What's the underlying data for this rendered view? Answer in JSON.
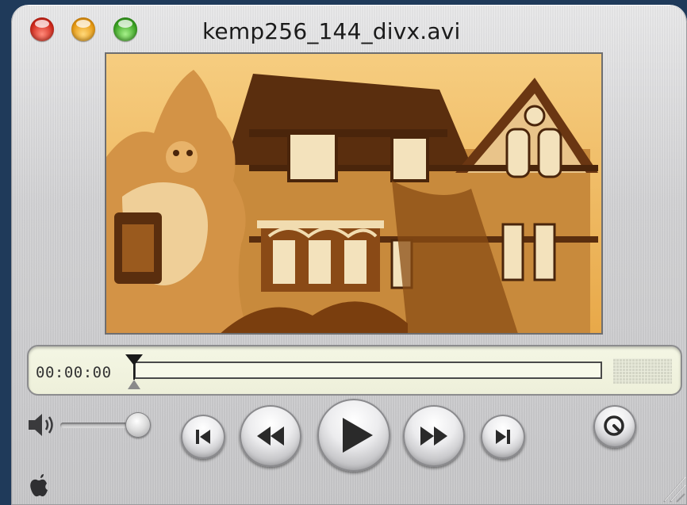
{
  "window": {
    "title": "kemp256_144_divx.avi",
    "traffic_lights": [
      "close-button",
      "minimize-button",
      "zoom-button"
    ]
  },
  "video": {
    "description_icon": "video-frame"
  },
  "timeline": {
    "timecode": "00:00:00",
    "progress": 0
  },
  "controls": {
    "volume_level": 1.0,
    "buttons": [
      "go-to-start",
      "rewind",
      "play",
      "fast-forward",
      "go-to-end"
    ],
    "extra_button_icon": "magnify-icon"
  },
  "colors": {
    "window_bg": "#d7d7d9",
    "timeline_bg": "#eff1dc",
    "video_tint": "#d99a3a"
  }
}
